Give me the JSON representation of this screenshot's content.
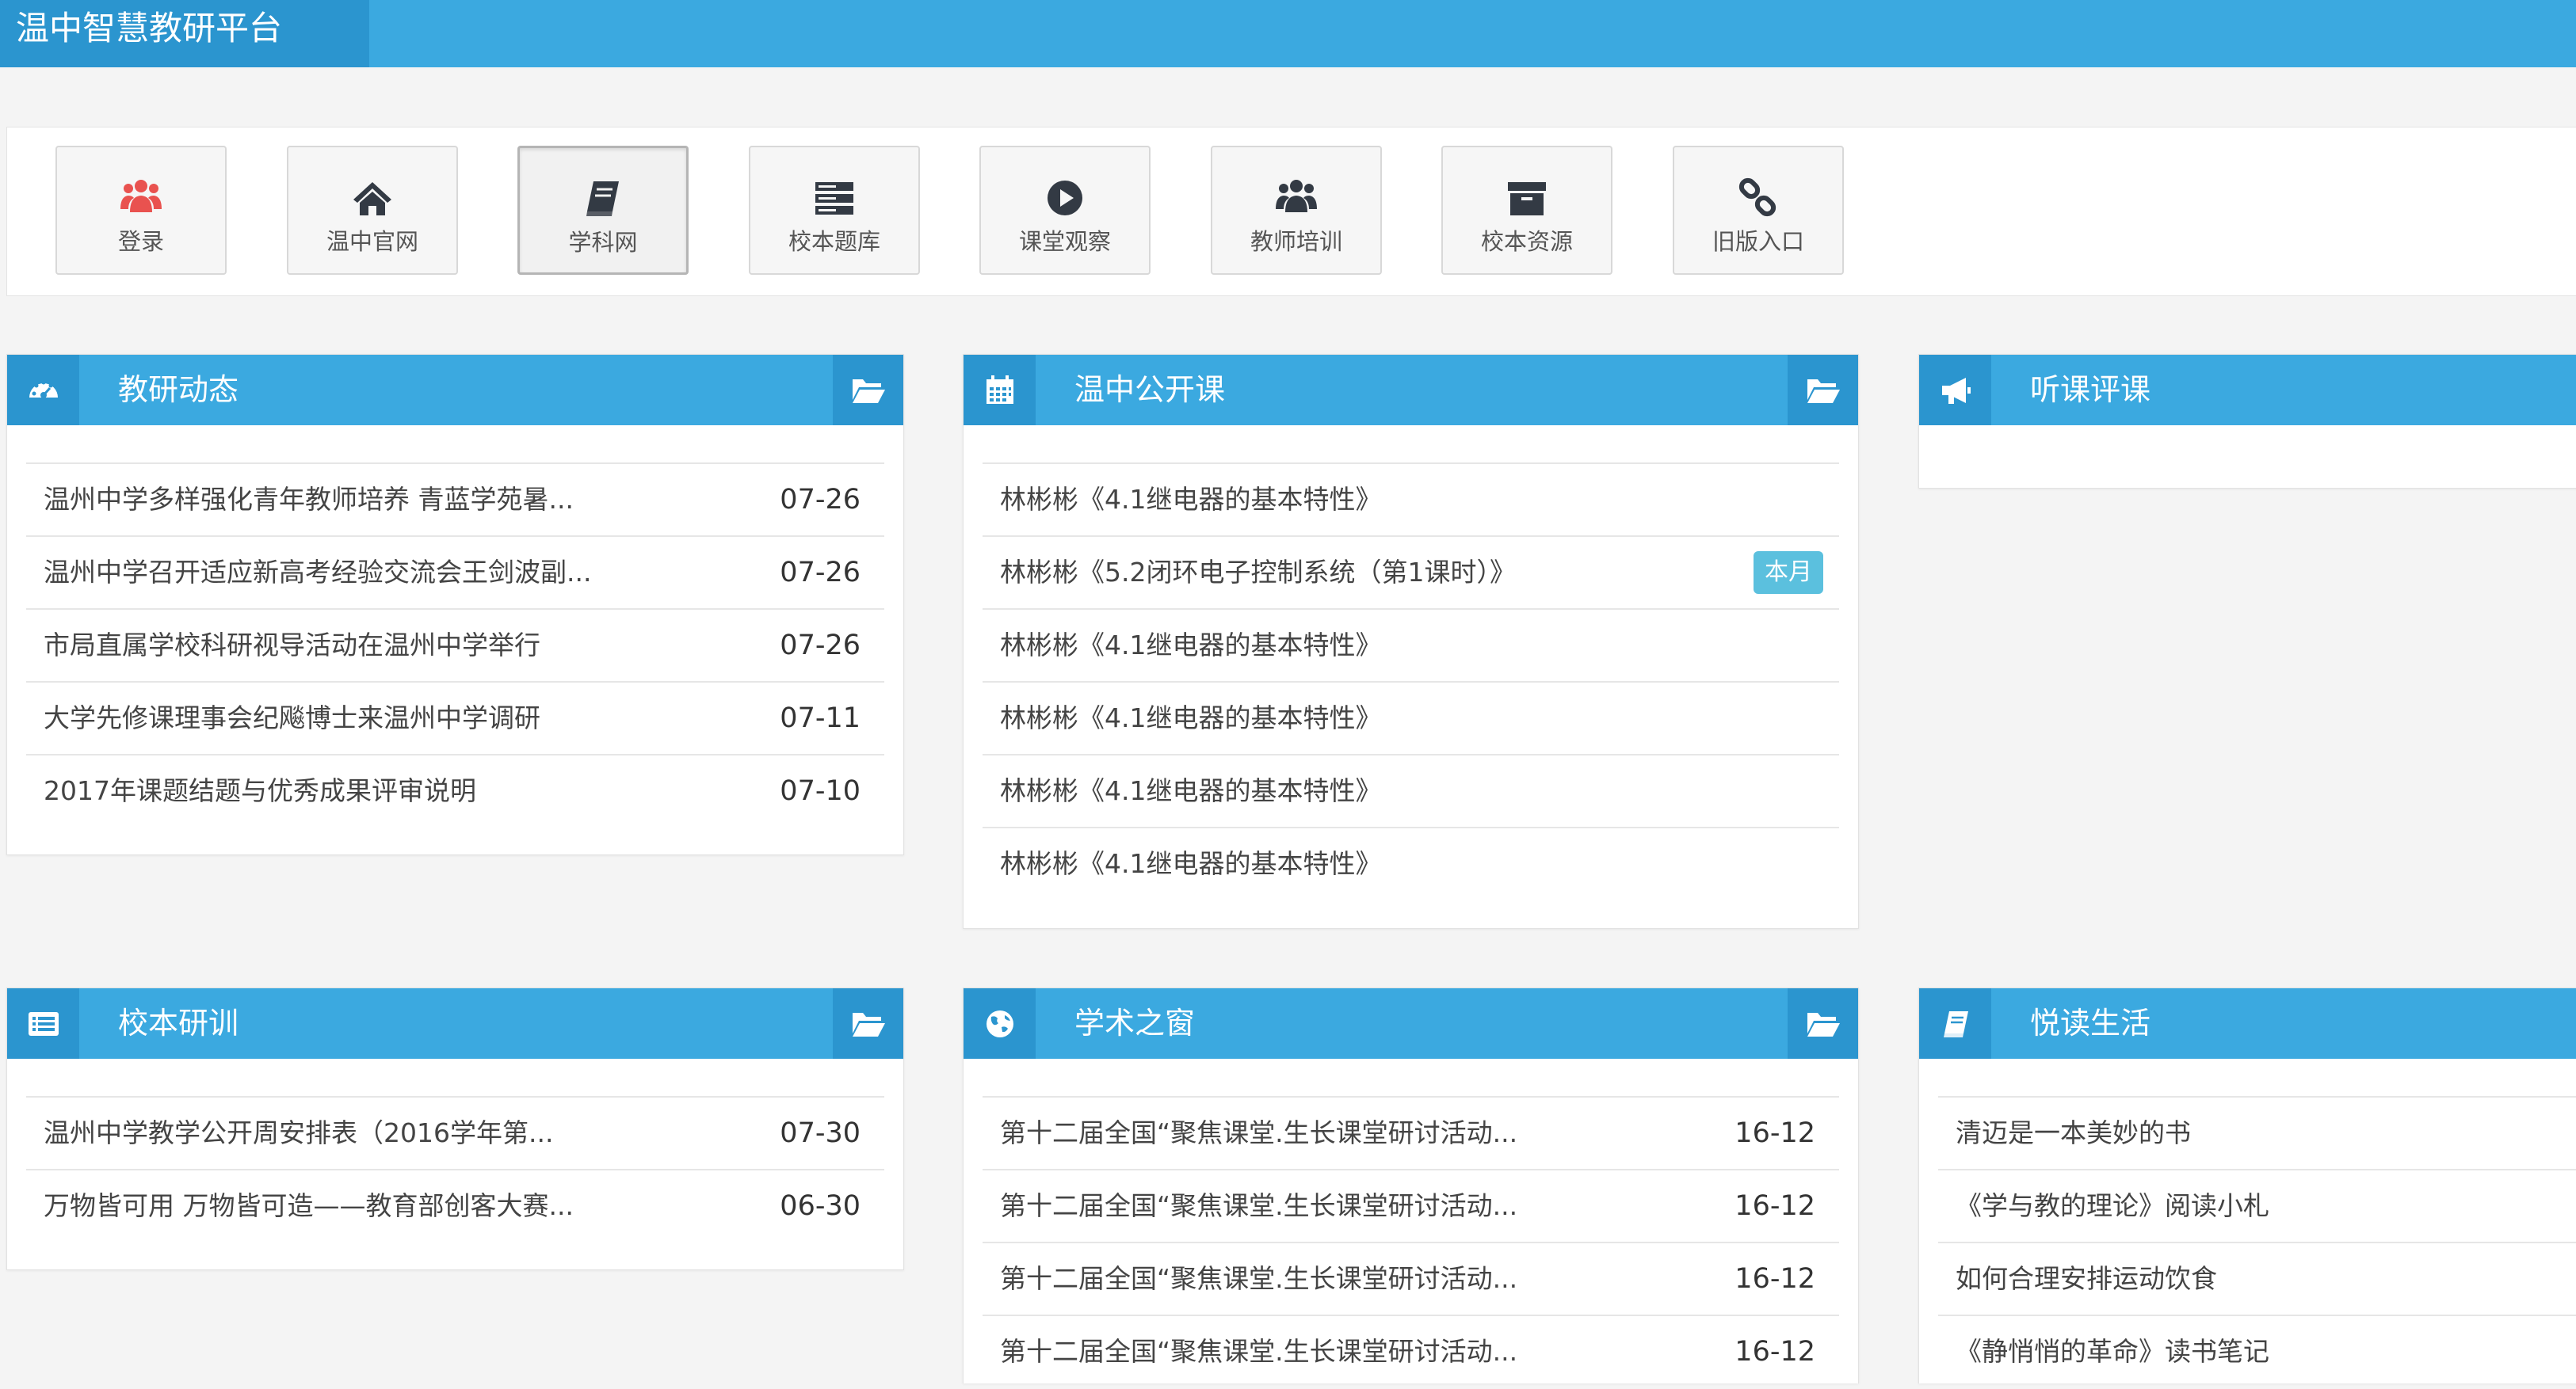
{
  "app": {
    "title": "温中智慧教研平台"
  },
  "colors": {
    "header": "#3ba9e0",
    "header_dark": "#2b95cf",
    "login_icon": "#e9524f",
    "nav_icon": "#333a44",
    "badge": "#5bc0de"
  },
  "nav": [
    {
      "label": "登录",
      "icon": "users-icon",
      "active": false
    },
    {
      "label": "温中官网",
      "icon": "home-icon",
      "active": false
    },
    {
      "label": "学科网",
      "icon": "book-icon",
      "active": true
    },
    {
      "label": "校本题库",
      "icon": "server-icon",
      "active": false
    },
    {
      "label": "课堂观察",
      "icon": "play-circle-icon",
      "active": false
    },
    {
      "label": "教师培训",
      "icon": "users-icon",
      "active": false
    },
    {
      "label": "校本资源",
      "icon": "archive-icon",
      "active": false
    },
    {
      "label": "旧版入口",
      "icon": "link-icon",
      "active": false
    }
  ],
  "panels": {
    "jiaoyan": {
      "title": "教研动态",
      "icon": "dashboard-icon",
      "items": [
        {
          "text": "温州中学多样强化青年教师培养 青蓝学苑暑...",
          "date": "07-26"
        },
        {
          "text": "温州中学召开适应新高考经验交流会王剑波副...",
          "date": "07-26"
        },
        {
          "text": "市局直属学校科研视导活动在温州中学举行",
          "date": "07-26"
        },
        {
          "text": "大学先修课理事会纪飚博士来温州中学调研",
          "date": "07-11"
        },
        {
          "text": "2017年课题结题与优秀成果评审说明",
          "date": "07-10"
        }
      ]
    },
    "gongkaike": {
      "title": "温中公开课",
      "icon": "calendar-icon",
      "items": [
        {
          "text": "林彬彬《4.1继电器的基本特性》",
          "badge": ""
        },
        {
          "text": "林彬彬《5.2闭环电子控制系统（第1课时）》",
          "badge": "本月"
        },
        {
          "text": "林彬彬《4.1继电器的基本特性》",
          "badge": ""
        },
        {
          "text": "林彬彬《4.1继电器的基本特性》",
          "badge": ""
        },
        {
          "text": "林彬彬《4.1继电器的基本特性》",
          "badge": ""
        },
        {
          "text": "林彬彬《4.1继电器的基本特性》",
          "badge": ""
        }
      ]
    },
    "tingke": {
      "title": "听课评课",
      "icon": "bullhorn-icon"
    },
    "xiaoben": {
      "title": "校本研训",
      "icon": "list-alt-icon",
      "items": [
        {
          "text": "温州中学教学公开周安排表（2016学年第...",
          "date": "07-30"
        },
        {
          "text": "万物皆可用 万物皆可造——教育部创客大赛...",
          "date": "06-30"
        }
      ]
    },
    "xueshu": {
      "title": "学术之窗",
      "icon": "globe-icon",
      "items": [
        {
          "text": "第十二届全国“聚焦课堂.生长课堂研讨活动...",
          "date": "16-12"
        },
        {
          "text": "第十二届全国“聚焦课堂.生长课堂研讨活动...",
          "date": "16-12"
        },
        {
          "text": "第十二届全国“聚焦课堂.生长课堂研讨活动...",
          "date": "16-12"
        },
        {
          "text": "第十二届全国“聚焦课堂.生长课堂研讨活动...",
          "date": "16-12"
        }
      ]
    },
    "yuedu": {
      "title": "悦读生活",
      "icon": "book-icon",
      "items": [
        {
          "text": "清迈是一本美妙的书"
        },
        {
          "text": "《学与教的理论》阅读小札"
        },
        {
          "text": "如何合理安排运动饮食"
        },
        {
          "text": "《静悄悄的革命》读书笔记"
        }
      ]
    }
  }
}
